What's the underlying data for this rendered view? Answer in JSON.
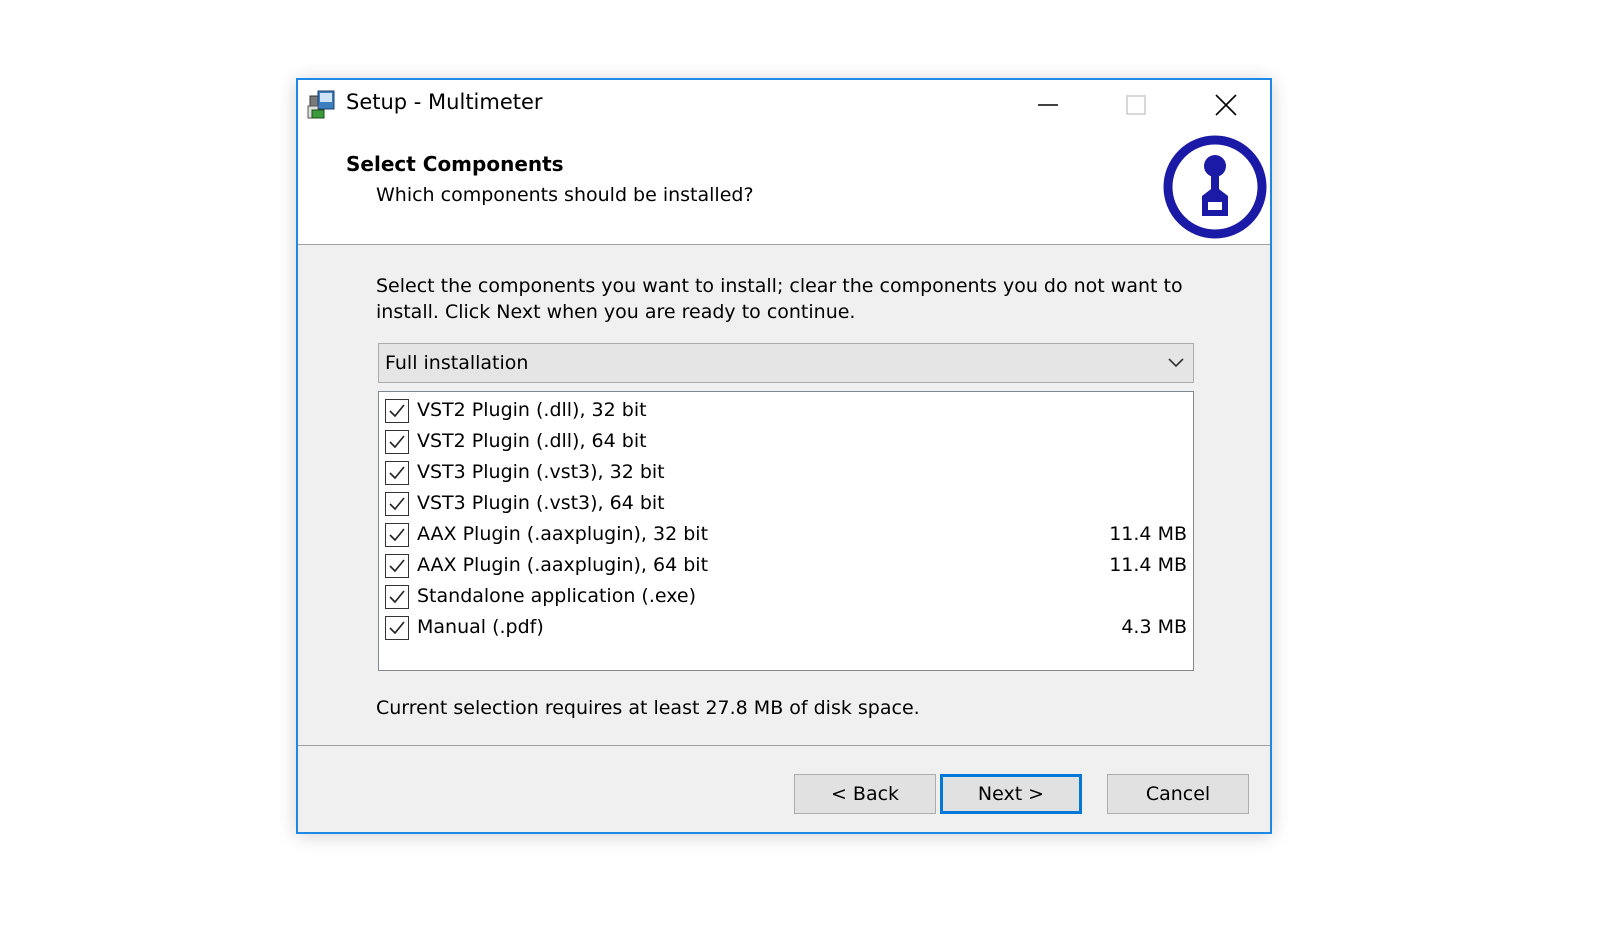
{
  "window": {
    "title": "Setup - Multimeter",
    "accent_color": "#1e88e5"
  },
  "titlebar_icons": [
    "setup-app-icon",
    "minimize-icon",
    "maximize-icon",
    "close-icon"
  ],
  "header": {
    "title": "Select Components",
    "subtitle": "Which components should be installed?",
    "logo_icon": "multimeter-logo-icon",
    "logo_color": "#1a1aa6"
  },
  "content": {
    "instructions": "Select the components you want to install; clear the components you do not want to install. Click Next when you are ready to continue.",
    "install_type": {
      "selected": "Full installation"
    },
    "components": [
      {
        "label": "VST2 Plugin (.dll), 32 bit",
        "size": "",
        "checked": true
      },
      {
        "label": "VST2 Plugin (.dll), 64 bit",
        "size": "",
        "checked": true
      },
      {
        "label": "VST3 Plugin (.vst3), 32 bit",
        "size": "",
        "checked": true
      },
      {
        "label": "VST3 Plugin (.vst3), 64 bit",
        "size": "",
        "checked": true
      },
      {
        "label": "AAX Plugin (.aaxplugin), 32 bit",
        "size": "11.4 MB",
        "checked": true
      },
      {
        "label": "AAX Plugin (.aaxplugin), 64 bit",
        "size": "11.4 MB",
        "checked": true
      },
      {
        "label": "Standalone application (.exe)",
        "size": "",
        "checked": true
      },
      {
        "label": "Manual (.pdf)",
        "size": "4.3 MB",
        "checked": true
      }
    ],
    "disk_space": "Current selection requires at least 27.8 MB of disk space."
  },
  "buttons": {
    "back": "< Back",
    "next": "Next >",
    "cancel": "Cancel"
  }
}
